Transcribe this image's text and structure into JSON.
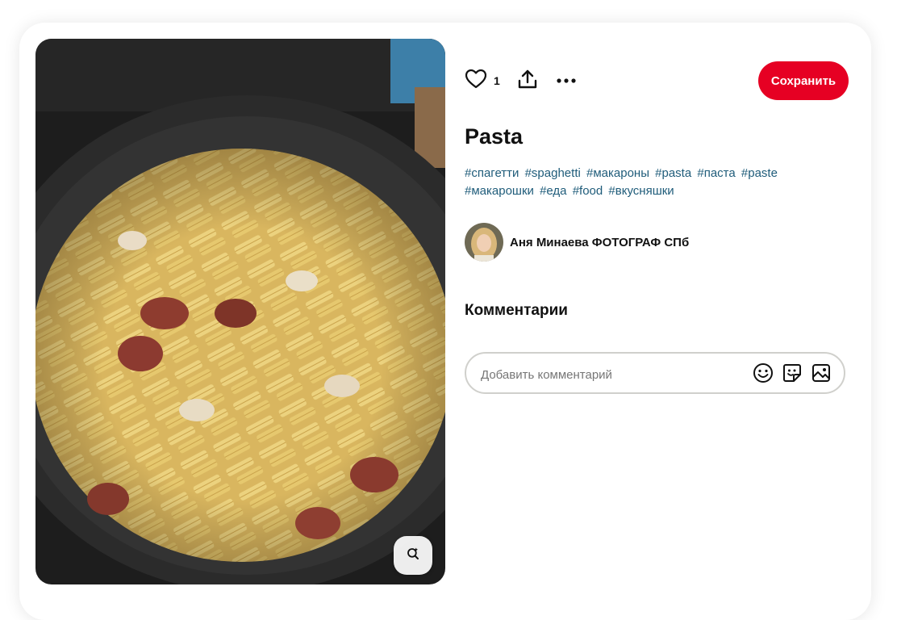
{
  "pin": {
    "image_description_icon": "pasta-photo",
    "likes_count": "1",
    "save_label": "Сохранить",
    "title": "Pasta",
    "tags": [
      "#спагетти",
      "#spaghetti",
      "#макароны",
      "#pasta",
      "#паста",
      "#paste",
      "#макарошки",
      "#еда",
      "#food",
      "#вкусняшки"
    ]
  },
  "author": {
    "name": "Аня Минаева ФОТОГРАФ СПб"
  },
  "comments": {
    "title": "Комментарии",
    "placeholder": "Добавить комментарий"
  },
  "icons": {
    "like": "heart-icon",
    "share": "share-icon",
    "more": "more-icon",
    "lens": "visual-search-icon",
    "emoji": "emoji-icon",
    "sticker": "sticker-icon",
    "image": "image-icon"
  },
  "colors": {
    "save_button": "#e60023",
    "hashtag": "#1f5c7a"
  }
}
